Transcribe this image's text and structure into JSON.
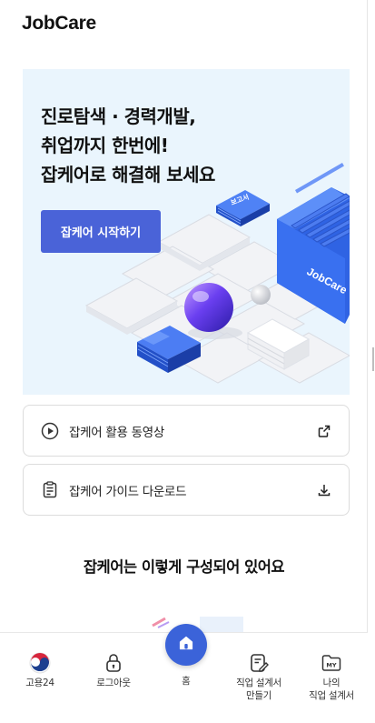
{
  "app": {
    "logo": "JobCare"
  },
  "hero": {
    "title_lines": [
      "진로탐색 · 경력개발,",
      "취업까지 한번에!",
      "잡케어로 해결해 보세요"
    ],
    "cta_label": "잡케어 시작하기",
    "art_label_small": "보고서",
    "art_label_big": "JobCare"
  },
  "links": {
    "video": {
      "label": "잡케어 활용 동영상",
      "lead_icon": "play-circle-icon",
      "trail_icon": "external-link-icon"
    },
    "guide": {
      "label": "잡케어 가이드 다운로드",
      "lead_icon": "document-icon",
      "trail_icon": "download-icon"
    }
  },
  "section": {
    "title": "잡케어는 이렇게 구성되어 있어요"
  },
  "bottom_nav": {
    "goyong": {
      "label": "고용24",
      "icon": "goyong24-logo-icon"
    },
    "logout": {
      "label": "로그아웃",
      "icon": "lock-icon"
    },
    "home": {
      "label": "홈",
      "icon": "home-icon"
    },
    "make": {
      "label_line1": "직업 설계서",
      "label_line2": "만들기",
      "icon": "edit-document-icon"
    },
    "my": {
      "label_line1": "나의",
      "label_line2": "직업 설계서",
      "icon": "my-folder-icon",
      "badge": "MY"
    }
  },
  "colors": {
    "accent": "#4a63d8",
    "hero_bg": "#eaf5fd",
    "fab": "#3b63d9"
  }
}
